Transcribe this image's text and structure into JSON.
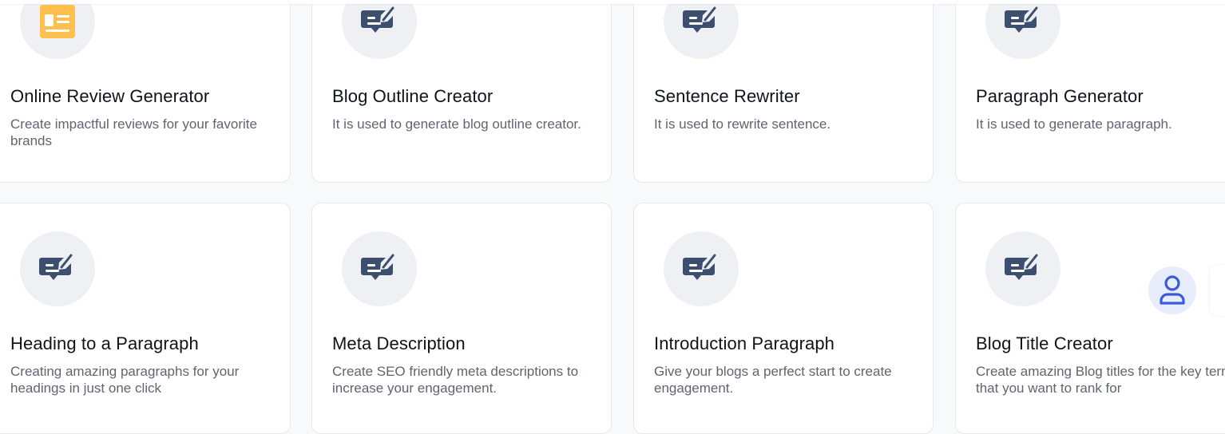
{
  "colors": {
    "page_background": "#f8f9fb",
    "card_background": "#ffffff",
    "icon_circle": "#eef0f4",
    "icon_dark": "#3d4f6e",
    "icon_orange": "#ffbf4d",
    "title_text": "#111318",
    "desc_text": "#5f6470",
    "avatar_blue": "#3b5bdb"
  },
  "cards": [
    {
      "icon": "review-document-icon",
      "title": "Online Review Generator",
      "description": "Create impactful reviews for your favorite brands"
    },
    {
      "icon": "chat-edit-icon",
      "title": "Blog Outline Creator",
      "description": "It is used to generate blog outline creator."
    },
    {
      "icon": "chat-edit-icon",
      "title": "Sentence Rewriter",
      "description": "It is used to rewrite sentence."
    },
    {
      "icon": "chat-edit-icon",
      "title": "Paragraph Generator",
      "description": "It is used to generate paragraph."
    },
    {
      "icon": "chat-edit-icon",
      "title": "Heading to a Paragraph",
      "description": "Creating amazing paragraphs for your headings in just one click"
    },
    {
      "icon": "chat-edit-icon",
      "title": "Meta Description",
      "description": "Create SEO friendly meta descriptions to increase your engagement."
    },
    {
      "icon": "chat-edit-icon",
      "title": "Introduction Paragraph",
      "description": "Give your blogs a perfect start to create engagement."
    },
    {
      "icon": "chat-edit-icon",
      "title": "Blog Title Creator",
      "description": "Create amazing Blog titles for the key terms that you want to rank for"
    }
  ],
  "floating": {
    "avatar_icon": "user-icon"
  }
}
